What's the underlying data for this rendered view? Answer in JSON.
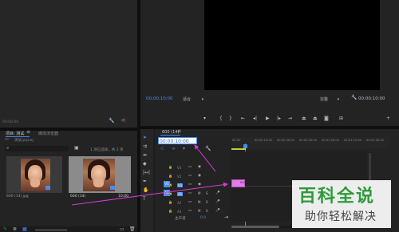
{
  "project_panel": {
    "tab_project": "项目: 测试",
    "tab_media_browser": "媒体浏览器",
    "file_name": "测试.prproj",
    "status": "1 项已选择，共 2 项",
    "clip1_name": "600 (14).jpg",
    "clip2_name": "600 (14)",
    "clip2_duration": "10:00"
  },
  "source_panel": {
    "timecode": "00:00:00"
  },
  "program_monitor": {
    "timecode_left": "00;00;10;00",
    "fit_label": "适合",
    "quality_label": "完整",
    "timecode_right": "00:00:10:00"
  },
  "timeline": {
    "tab_label": "600 (14)",
    "timecode_input": "00:00:10:00",
    "ruler_labels": [
      "00:00",
      "00:00:15:00",
      "00:00:30:00",
      "00:00:45:00",
      "00:01:00:00",
      "00:01:15:00",
      "00:01:30:00"
    ],
    "video_tracks": [
      "V3",
      "V2",
      "V1"
    ],
    "audio_tracks": [
      "A1",
      "A2",
      "A3"
    ],
    "master_label": "主声道",
    "master_value": "0.0",
    "clip_label": "600",
    "toggle_v": "V1",
    "toggle_a": "A1"
  },
  "watermark": {
    "title": "百科全说",
    "subtitle": "助你轻松解决"
  },
  "colors": {
    "accent_blue": "#4a8cf0",
    "pink_arrow": "#d23cd2",
    "clip_pink": "#e07ee6",
    "watermark_green": "#2e9a3a"
  }
}
